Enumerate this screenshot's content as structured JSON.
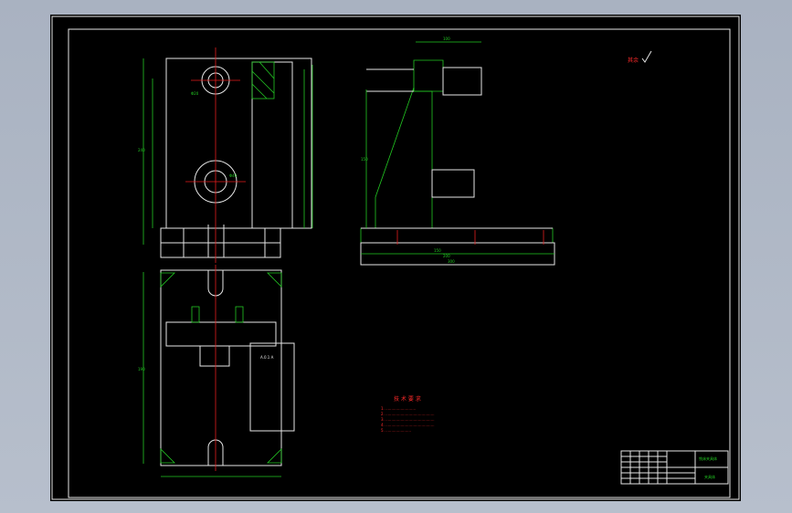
{
  "colors": {
    "background": "#000000",
    "outline": "#e6e6e6",
    "dimension": "#22c822",
    "centerline": "#e41d1d",
    "note": "#ff2a2a",
    "viewport": "#aab3c2"
  },
  "dimensions": {
    "plan_width": "190",
    "plan_height": "240",
    "side_height": "150",
    "side_base_1": "150",
    "side_base_2": "200",
    "side_base_3": "300",
    "side_top": "100",
    "dia_1": "Φ20",
    "dia_2": "Φ40"
  },
  "notes": {
    "heading": "技 术 要 求",
    "lines": [
      "1. ..........................",
      "2. ..........................................",
      "3. ..........................................",
      "4. ..........................................",
      "5. ......................"
    ]
  },
  "title_block": {
    "name": "铣床夹具体",
    "drawing_no": "夹具体"
  },
  "roughness": {
    "label": "其余"
  }
}
